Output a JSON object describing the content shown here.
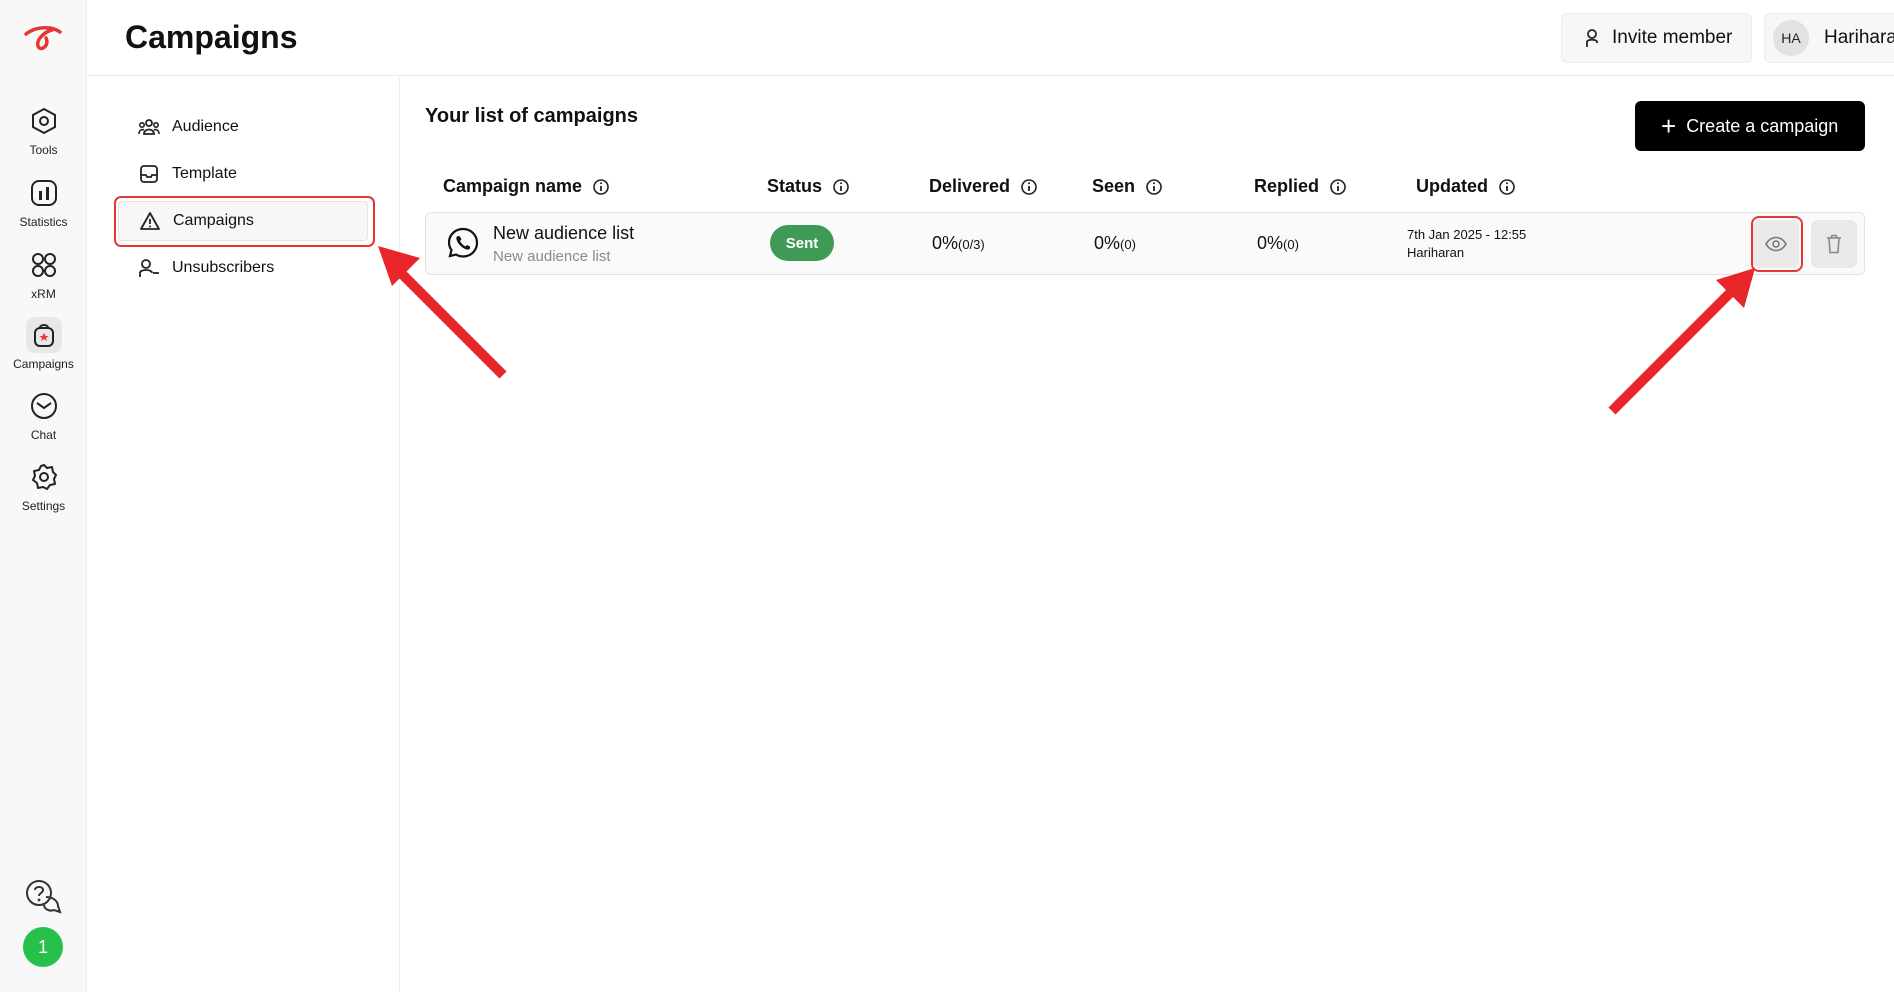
{
  "header": {
    "title": "Campaigns",
    "invite_label": "Invite member",
    "user_initials": "HA",
    "user_name": "Hariharan"
  },
  "rail": {
    "items": [
      {
        "label": "Tools",
        "icon": "hexagon-icon"
      },
      {
        "label": "Statistics",
        "icon": "bar-chart-icon"
      },
      {
        "label": "xRM",
        "icon": "grid-icon"
      },
      {
        "label": "Campaigns",
        "icon": "campaign-bag-icon"
      },
      {
        "label": "Chat",
        "icon": "chat-icon"
      },
      {
        "label": "Settings",
        "icon": "gear-icon"
      }
    ],
    "notification_count": "1"
  },
  "subnav": {
    "items": [
      {
        "label": "Audience",
        "icon": "audience-icon"
      },
      {
        "label": "Template",
        "icon": "template-icon"
      },
      {
        "label": "Campaigns",
        "icon": "warning-triangle-icon"
      },
      {
        "label": "Unsubscribers",
        "icon": "user-minus-icon"
      }
    ]
  },
  "main": {
    "title": "Your list of campaigns",
    "create_label": "Create a campaign",
    "columns": [
      "Campaign name",
      "Status",
      "Delivered",
      "Seen",
      "Replied",
      "Updated"
    ],
    "rows": [
      {
        "name": "New audience list",
        "subtitle": "New audience list",
        "status": "Sent",
        "delivered_pct": "0%",
        "delivered_detail": "(0/3)",
        "seen_pct": "0%",
        "seen_detail": "(0)",
        "replied_pct": "0%",
        "replied_detail": "(0)",
        "updated_date": "7th Jan 2025 - 12:55",
        "updated_by": "Hariharan"
      }
    ]
  },
  "colors": {
    "accent": "#e53535",
    "status_sent": "#3f9a55",
    "notification": "#27c04a"
  }
}
